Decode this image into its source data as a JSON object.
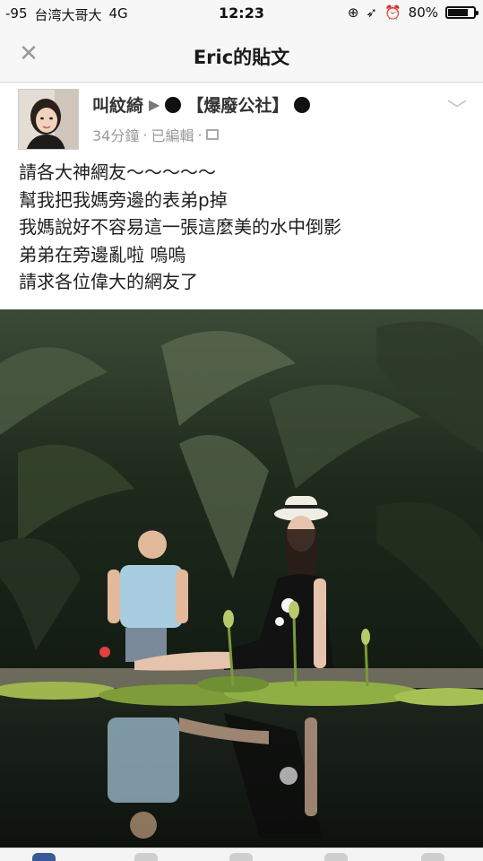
{
  "status_bar": {
    "signal": "-95",
    "carrier": "台湾大哥大",
    "network": "4G",
    "time": "12:23",
    "battery_percent": "80%",
    "battery_level": 0.8,
    "icons": [
      "orientation-lock-icon",
      "location-icon",
      "alarm-icon",
      "battery-icon"
    ]
  },
  "nav": {
    "title": "Eric的貼文",
    "close_icon": "close-icon"
  },
  "post": {
    "author": "叫紋綺",
    "group": "【爆廢公社】",
    "time_ago": "34分鐘",
    "edited": "已編輯",
    "separator": "·",
    "text_lines": [
      "請各大神網友～～～～～",
      "幫我把我媽旁邊的表弟p掉",
      "我媽說好不容易這一張這麼美的水中倒影",
      "弟弟在旁邊亂啦 嗚嗚",
      "請求各位偉大的網友了"
    ]
  },
  "colors": {
    "accent": "#3b5998",
    "muted": "#9a9a9a"
  }
}
